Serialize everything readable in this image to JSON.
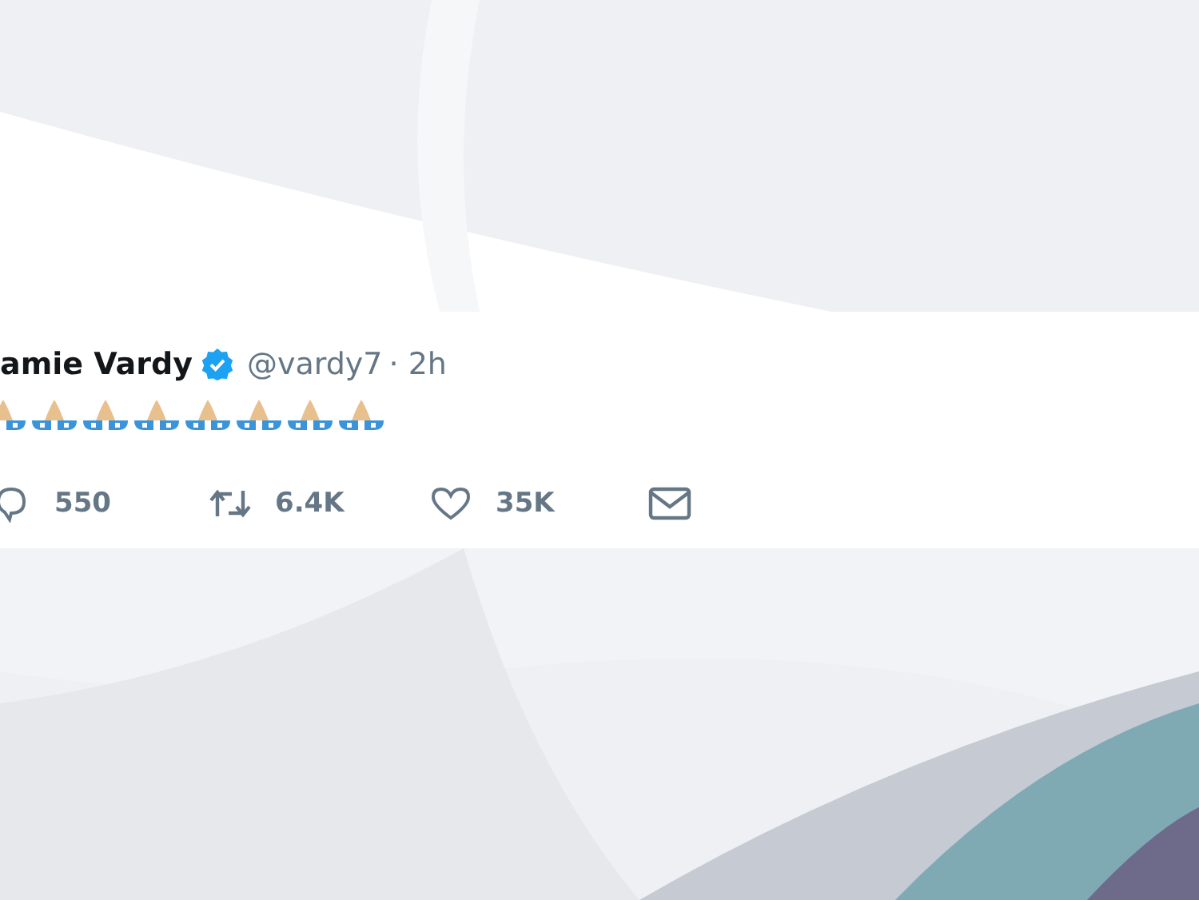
{
  "tweet": {
    "display_name": "amie Vardy",
    "verified": true,
    "handle": "@vardy7",
    "time": "· 2h"
  },
  "actions": [
    {
      "kind": "reply",
      "count": "550"
    },
    {
      "kind": "retweet",
      "count": "6.4K"
    },
    {
      "kind": "like",
      "count": "35K"
    },
    {
      "kind": "message"
    }
  ]
}
